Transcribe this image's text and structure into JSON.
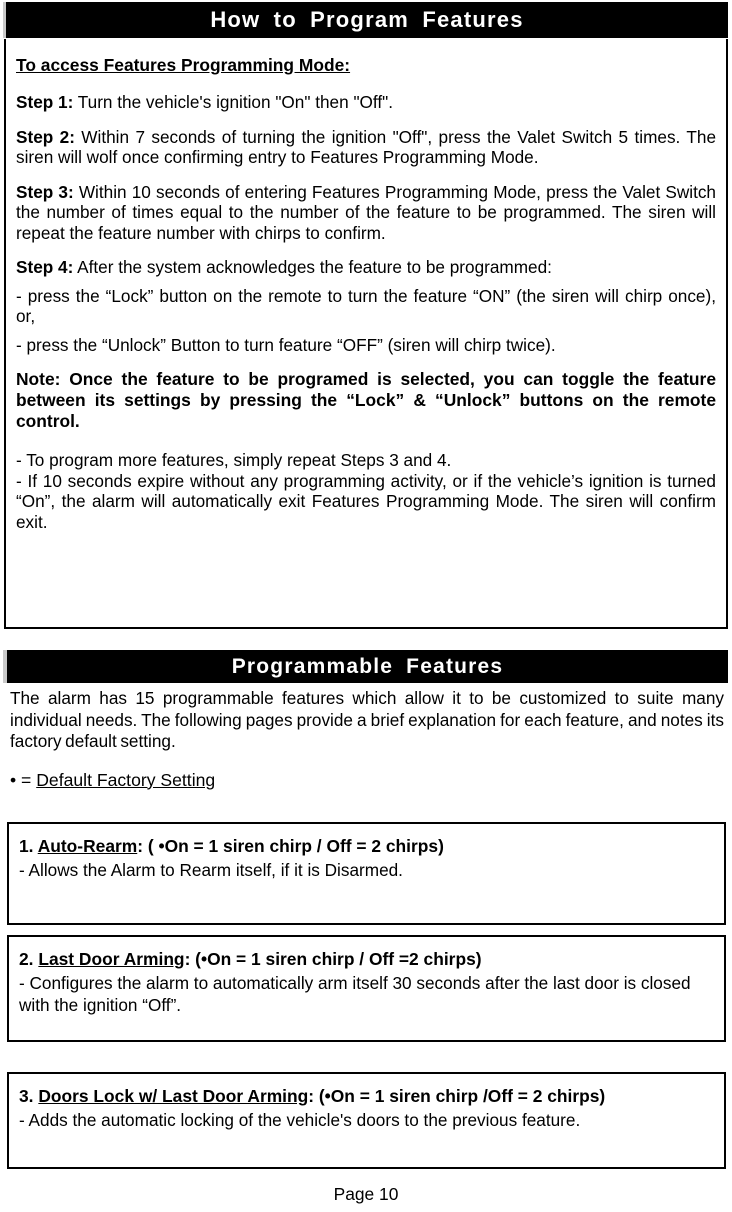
{
  "page": {
    "footer_label": "Page 10"
  },
  "section_how_to": {
    "title": "How to Program Features",
    "heading": "To access Features Programming Mode:",
    "steps": [
      {
        "label": "Step 1:",
        "text": " Turn the vehicle's ignition \"On\" then \"Off\"."
      },
      {
        "label": "Step 2:",
        "text": " Within 7 seconds of turning the ignition \"Off\", press the Valet Switch 5 times. The siren will wolf once confirming entry to Features Programming Mode."
      },
      {
        "label": "Step 3:",
        "text": " Within 10 seconds of entering Features Programming Mode, press the Valet Switch the number of times equal to the number of the feature to be programmed.  The siren will repeat the feature number with chirps to confirm."
      },
      {
        "label": "Step 4:",
        "text": " After the system acknowledges the feature to be programmed:"
      }
    ],
    "bullets": [
      "- press the “Lock” button on the remote to turn the feature “ON” (the siren will chirp once), or,",
      "- press the “Unlock” Button to turn feature “OFF” (siren will chirp twice)."
    ],
    "note": "Note: Once the feature to be programed is selected,  you can toggle the feature between its settings by pressing the “Lock” & “Unlock” buttons on the remote control.",
    "trailing_bullets": [
      "- To program more features, simply repeat Steps 3 and 4.",
      "- If 10 seconds expire without any programming activity, or if the vehicle’s ignition is turned “On”, the alarm will automatically exit Features Programming Mode. The siren will confirm exit."
    ]
  },
  "section_programmable": {
    "title": "Programmable Features",
    "intro": "The alarm has 15 programmable features which allow it to be customized to suite many individual needs.  The following pages provide a brief explanation for each feature, and notes its factory default setting.",
    "legend_prefix": "• = ",
    "legend_underlined": "Default Factory Setting",
    "features": [
      {
        "number": "1. ",
        "name": "Auto-Rearm",
        "settings": ": ( •On = 1 siren chirp / Off = 2 chirps)",
        "description": "- Allows the Alarm to Rearm itself, if it is Disarmed."
      },
      {
        "number": "2. ",
        "name": "Last Door Arming",
        "settings": ": (•On = 1 siren chirp / Off =2 chirps)",
        "description": "- Configures the alarm to automatically arm itself 30 seconds after the last door is closed with the ignition “Off”."
      },
      {
        "number": "3. ",
        "name": "Doors Lock w/ Last Door Arming",
        "settings": ": (•On = 1 siren chirp /Off = 2 chirps)",
        "description": "- Adds the automatic locking of the vehicle's doors to the previous feature."
      }
    ]
  }
}
